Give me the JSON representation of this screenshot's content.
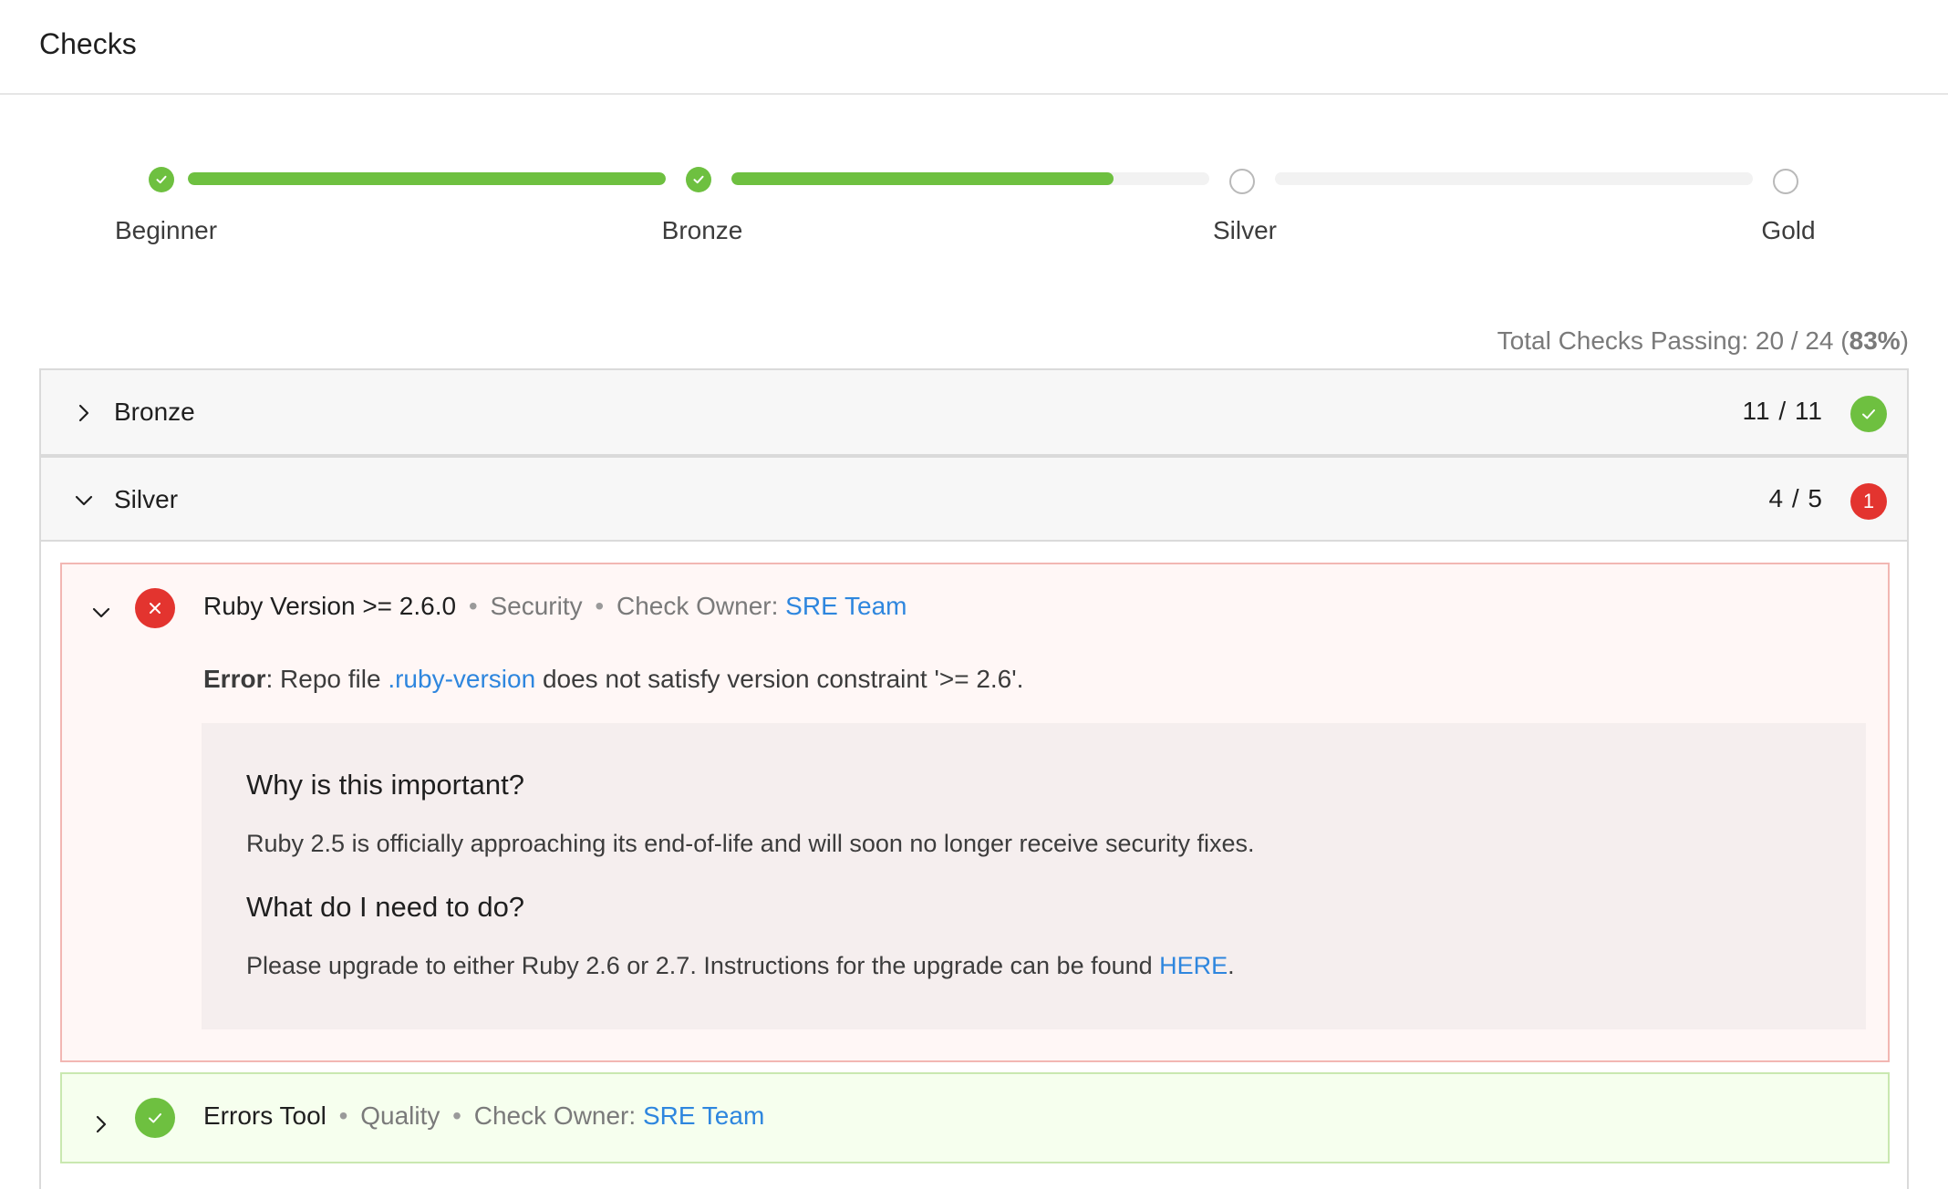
{
  "header": {
    "title": "Checks"
  },
  "stepper": {
    "steps": [
      {
        "label": "Beginner",
        "status": "complete"
      },
      {
        "label": "Bronze",
        "status": "complete"
      },
      {
        "label": "Silver",
        "status": "incomplete"
      },
      {
        "label": "Gold",
        "status": "incomplete"
      }
    ],
    "segments_progress": [
      1.0,
      0.8,
      0.0
    ]
  },
  "summary": {
    "prefix": "Total Checks Passing: 20 / 24 (",
    "percent": "83%",
    "suffix": ")"
  },
  "levels": [
    {
      "name": "Bronze",
      "count": "11 / 11",
      "status": "passing",
      "expanded": false
    },
    {
      "name": "Silver",
      "count": "4 / 5",
      "status": "failing",
      "failing_count": "1",
      "expanded": true
    }
  ],
  "checks": [
    {
      "name": "Ruby Version >= 2.6.0",
      "category": "Security",
      "owner_label": "Check Owner:",
      "owner": "SRE Team",
      "separator": "•",
      "status": "failing",
      "error_label": "Error",
      "error_pre": ": Repo file ",
      "error_file": ".ruby-version",
      "error_post": " does not satisfy version constraint '>= 2.6'.",
      "why_heading": "Why is this important?",
      "why_text": "Ruby 2.5 is officially approaching its end-of-life and will soon no longer receive security fixes.",
      "todo_heading": "What do I need to do?",
      "todo_text": "Please upgrade to either Ruby 2.6 or 2.7. Instructions for the upgrade can be found ",
      "todo_link": "HERE",
      "todo_end": "."
    },
    {
      "name": "Errors Tool",
      "category": "Quality",
      "owner_label": "Check Owner:",
      "owner": "SRE Team",
      "separator": "•",
      "status": "passing"
    }
  ],
  "colors": {
    "success": "#6ec040",
    "danger": "#e3342f",
    "link": "#2e86de"
  }
}
